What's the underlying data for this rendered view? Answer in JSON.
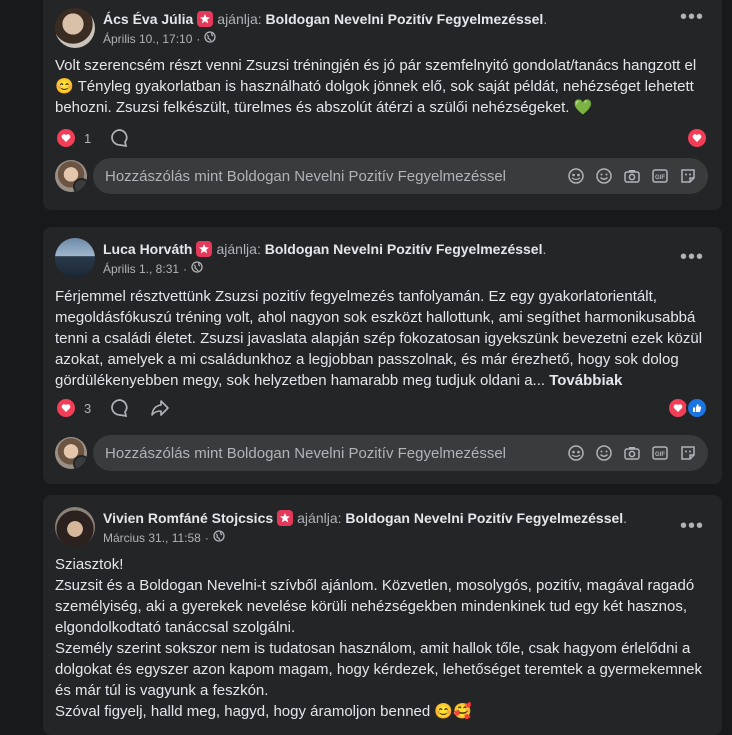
{
  "posts": [
    {
      "author": "Ács Éva Júlia",
      "recommends_label": "ajánlja:",
      "page": "Boldogan Nevelni Pozitív Fegyelmezéssel",
      "page_suffix": ".",
      "time": "Április 10., 17:10",
      "time_sep": "·",
      "text_lines": [
        "Volt szerencsém részt venni Zsuzsi tréningjén és jó pár szemfelnyitó gondolat/tanács hangzott el",
        "Tényleg gyakorlatban is használható dolgok jönnek elő, sok saját példát, nehézséget lehetett",
        "behozni. Zsuzsi felkészült, türelmes és abszolút átérzi a szülői nehézségeket."
      ],
      "emoji_start": "😊",
      "emoji_end": "💚",
      "reaction_count": "1",
      "comment_placeholder": "Hozzászólás mint Boldogan Nevelni Pozitív Fegyelmezéssel"
    },
    {
      "author": "Luca Horváth",
      "recommends_label": "ajánlja:",
      "page": "Boldogan Nevelni Pozitív Fegyelmezéssel",
      "page_suffix": ".",
      "time": "Április 1., 8:31",
      "time_sep": "·",
      "text_lines": [
        "Férjemmel résztvettünk Zsuzsi pozitív fegyelmezés tanfolyamán. Ez egy gyakorlatorientált,",
        "megoldásfókuszú tréning volt, ahol nagyon sok eszközt hallottunk, ami segíthet harmonikusabbá",
        "tenni a családi életet. Zsuzsi javaslata alapján szép fokozatosan igyekszünk bevezetni ezek közül",
        "azokat, amelyek a mi családunkhoz a legjobban passzolnak, és már érezhető, hogy sok dolog",
        "gördülékenyebben megy, sok helyzetben hamarabb meg tudjuk oldani a..."
      ],
      "more_label": "Továbbiak",
      "reaction_count": "3",
      "comment_placeholder": "Hozzászólás mint Boldogan Nevelni Pozitív Fegyelmezéssel"
    },
    {
      "author": "Vivien Romfáné Stojcsics",
      "recommends_label": "ajánlja:",
      "page": "Boldogan Nevelni Pozitív Fegyelmezéssel",
      "page_suffix": ".",
      "time": "Március 31., 11:58",
      "time_sep": "·",
      "text_lines": [
        "Sziasztok!",
        "Zsuzsit és a Boldogan Nevelni-t szívből ajánlom. Közvetlen, mosolygós, pozitív, magával ragadó",
        "személyiség, aki a gyerekek nevelése körüli nehézségekben mindenkinek tud egy két hasznos,",
        "elgondolkodtató tanáccsal szolgálni.",
        "Személy szerint sokszor nem is tudatosan használom, amit hallok tőle, csak hagyom érlelődni a",
        "dolgokat és egyszer azon kapom magam, hogy kérdezek, lehetőséget teremtek a gyermekemnek",
        "és már túl is vagyunk a feszkón.",
        "Szóval figyelj, halld meg, hagyd, hogy áramoljon benned"
      ],
      "emoji_end": "😊🥰"
    }
  ],
  "colors": {
    "background": "#18191a",
    "card": "#242526",
    "heart": "#f33e58",
    "like": "#1b74e4",
    "badge": "#e4395a"
  }
}
